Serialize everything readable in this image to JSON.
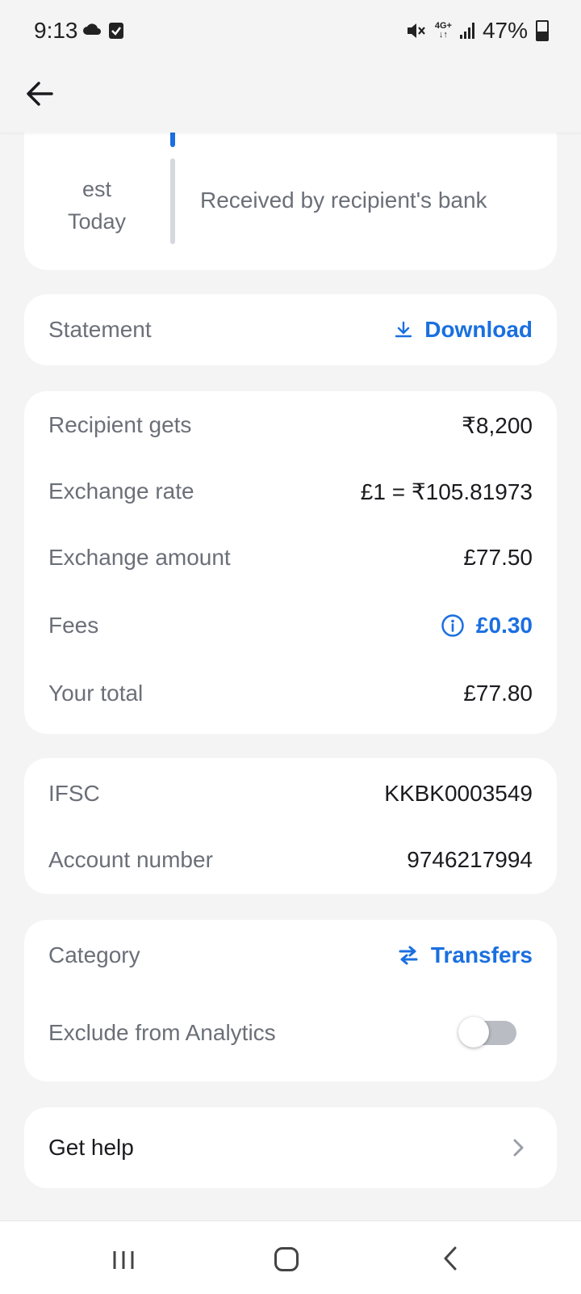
{
  "status_bar": {
    "time": "9:13",
    "network": "4G+",
    "battery": "47%",
    "icons": [
      "cloud-icon",
      "check-box-icon",
      "mute-icon",
      "signal-icon",
      "battery-icon"
    ]
  },
  "app_bar": {
    "back_icon": "arrow-left-icon"
  },
  "timeline": {
    "when_line1": "est",
    "when_line2": "Today",
    "label": "Received by recipient's bank"
  },
  "statement": {
    "label": "Statement",
    "action_label": "Download",
    "action_icon": "download-icon"
  },
  "details": [
    {
      "label": "Recipient gets",
      "value": "₹8,200"
    },
    {
      "label": "Exchange rate",
      "value": "£1 = ₹105.81973"
    },
    {
      "label": "Exchange amount",
      "value": "£77.50"
    },
    {
      "label": "Fees",
      "value": "£0.30",
      "icon": "info-icon"
    },
    {
      "label": "Your total",
      "value": "£77.80"
    }
  ],
  "bank": [
    {
      "label": "IFSC",
      "value": "KKBK0003549"
    },
    {
      "label": "Account number",
      "value": "9746217994"
    }
  ],
  "category": {
    "label": "Category",
    "value": "Transfers",
    "icon": "transfer-arrows-icon"
  },
  "exclude": {
    "label": "Exclude from Analytics",
    "toggle_on": false
  },
  "help": {
    "label": "Get help",
    "icon": "chevron-right-icon"
  },
  "colors": {
    "accent": "#1a6fe0",
    "background": "#f4f4f5",
    "card": "#ffffff",
    "label_text": "#6b6f78",
    "value_text": "#1b1b1f"
  }
}
